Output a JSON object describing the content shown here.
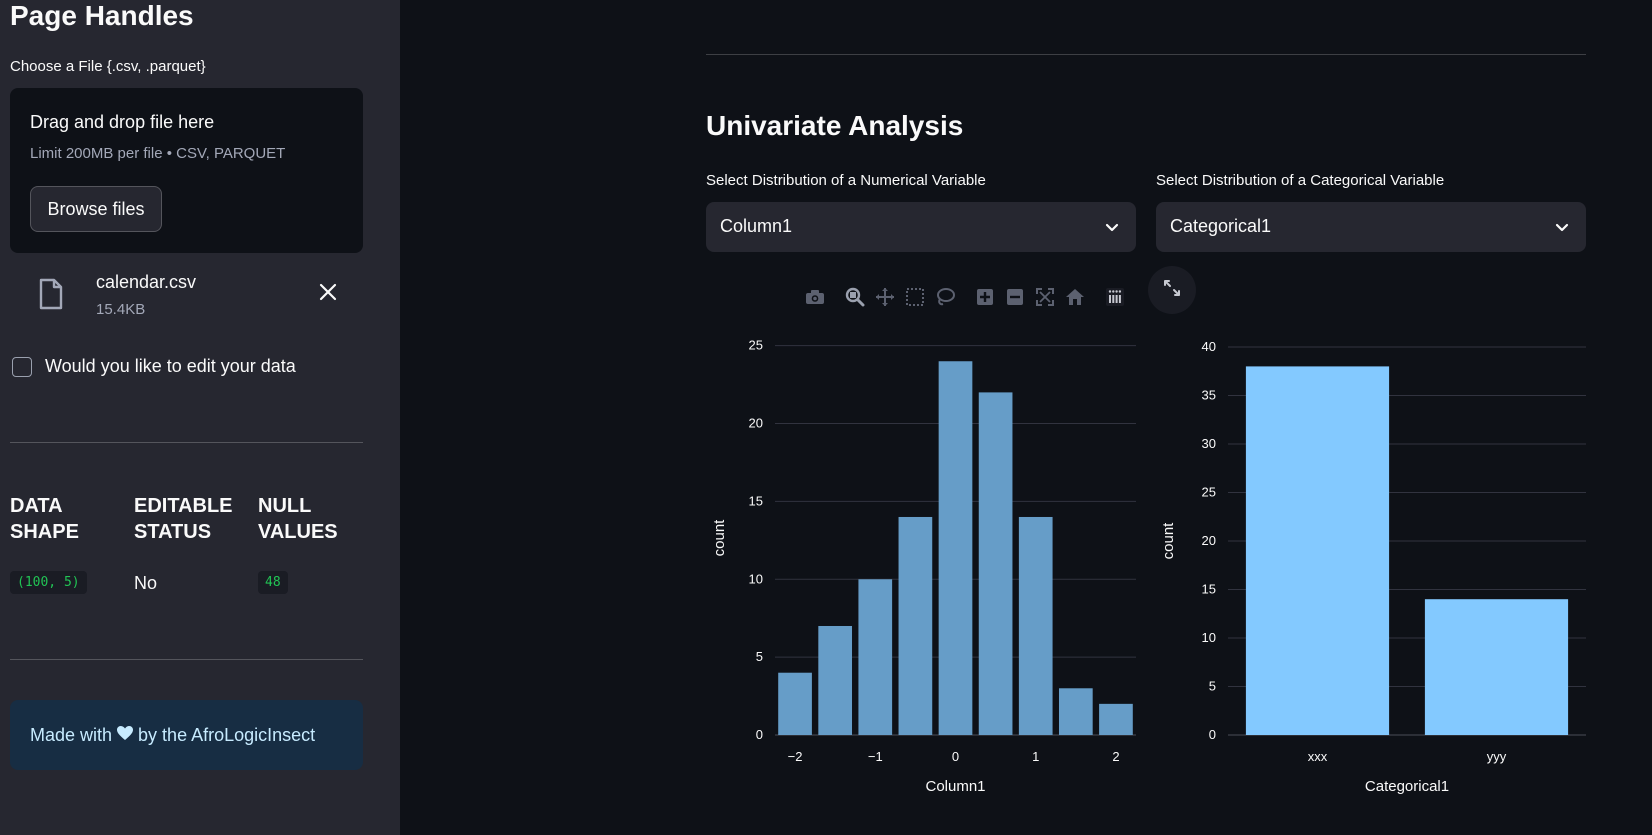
{
  "sidebar": {
    "title": "Page Handles",
    "uploader_label": "Choose a File {.csv, .parquet}",
    "dropzone_title": "Drag and drop file here",
    "dropzone_limit": "Limit 200MB per file • CSV, PARQUET",
    "browse_label": "Browse files",
    "file": {
      "name": "calendar.csv",
      "size": "15.4KB"
    },
    "edit_checkbox_label": "Would you like to edit your data",
    "edit_checked": false,
    "metrics": [
      {
        "label_line1": "DATA",
        "label_line2": "SHAPE",
        "value": "(100, 5)",
        "style": "code"
      },
      {
        "label_line1": "EDITABLE",
        "label_line2": "STATUS",
        "value": "No",
        "style": "plain"
      },
      {
        "label_line1": "NULL",
        "label_line2": "VALUES",
        "value": "48",
        "style": "code"
      }
    ],
    "footer_prefix": "Made with",
    "footer_suffix": "by the AfroLogicInsect"
  },
  "main": {
    "section_title": "Univariate Analysis",
    "numerical_select": {
      "label": "Select Distribution of a Numerical Variable",
      "value": "Column1"
    },
    "categorical_select": {
      "label": "Select Distribution of a Categorical Variable",
      "value": "Categorical1"
    }
  },
  "colors": {
    "histogram_bar": "#669dc8",
    "category_bar": "#83c9ff",
    "background": "#0e1117",
    "sidebar": "#262730"
  },
  "chart_data": [
    {
      "type": "bar",
      "subtype": "histogram",
      "x": [
        -2,
        -1.5,
        -1,
        -0.5,
        0,
        0.5,
        1,
        1.5,
        2
      ],
      "values": [
        4,
        7,
        10,
        14,
        24,
        22,
        14,
        3,
        2
      ],
      "xlabel": "Column1",
      "ylabel": "count",
      "xticks": [
        -2,
        -1,
        0,
        1,
        2
      ],
      "xtick_labels": [
        "−2",
        "−1",
        "0",
        "1",
        "2"
      ],
      "yticks": [
        0,
        5,
        10,
        15,
        20,
        25
      ],
      "ylim": [
        0,
        25.3
      ],
      "xlim": [
        -2.25,
        2.25
      ],
      "grid": true
    },
    {
      "type": "bar",
      "categories": [
        "xxx",
        "yyy"
      ],
      "values": [
        38,
        14
      ],
      "xlabel": "Categorical1",
      "ylabel": "count",
      "yticks": [
        0,
        5,
        10,
        15,
        20,
        25,
        30,
        35,
        40
      ],
      "ylim": [
        0,
        40
      ],
      "grid": true
    }
  ]
}
